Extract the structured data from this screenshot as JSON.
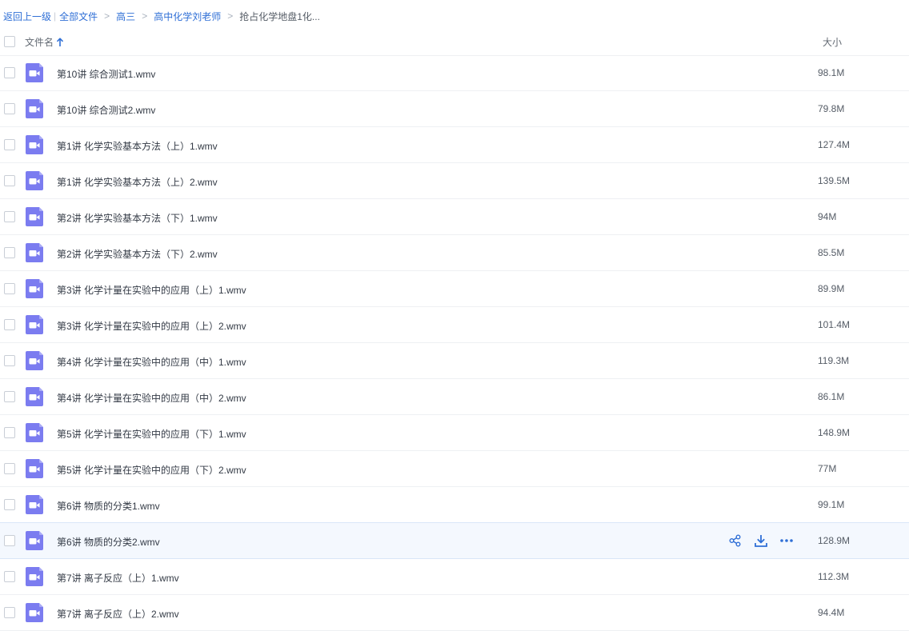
{
  "breadcrumb": {
    "back": "返回上一级",
    "pipe": "|",
    "items": [
      "全部文件",
      "高三",
      "高中化学刘老师"
    ],
    "sep": ">",
    "current": "抢占化学地盘1化..."
  },
  "header": {
    "name_label": "文件名",
    "size_label": "大小",
    "sort": "ascending"
  },
  "colors": {
    "accent": "#2f6fd6",
    "file_icon": "#7b7cf0",
    "hover_row": "#f4f8fe"
  },
  "files": [
    {
      "name": "第10讲 综合测试1.wmv",
      "size": "98.1M",
      "icon": "video-file-icon"
    },
    {
      "name": "第10讲 综合测试2.wmv",
      "size": "79.8M",
      "icon": "video-file-icon"
    },
    {
      "name": "第1讲 化学实验基本方法（上）1.wmv",
      "size": "127.4M",
      "icon": "video-file-icon"
    },
    {
      "name": "第1讲 化学实验基本方法（上）2.wmv",
      "size": "139.5M",
      "icon": "video-file-icon"
    },
    {
      "name": "第2讲 化学实验基本方法（下）1.wmv",
      "size": "94M",
      "icon": "video-file-icon"
    },
    {
      "name": "第2讲 化学实验基本方法（下）2.wmv",
      "size": "85.5M",
      "icon": "video-file-icon"
    },
    {
      "name": "第3讲 化学计量在实验中的应用（上）1.wmv",
      "size": "89.9M",
      "icon": "video-file-icon"
    },
    {
      "name": "第3讲 化学计量在实验中的应用（上）2.wmv",
      "size": "101.4M",
      "icon": "video-file-icon"
    },
    {
      "name": "第4讲 化学计量在实验中的应用（中）1.wmv",
      "size": "119.3M",
      "icon": "video-file-icon"
    },
    {
      "name": "第4讲 化学计量在实验中的应用（中）2.wmv",
      "size": "86.1M",
      "icon": "video-file-icon"
    },
    {
      "name": "第5讲 化学计量在实验中的应用（下）1.wmv",
      "size": "148.9M",
      "icon": "video-file-icon"
    },
    {
      "name": "第5讲 化学计量在实验中的应用（下）2.wmv",
      "size": "77M",
      "icon": "video-file-icon"
    },
    {
      "name": "第6讲 物质的分类1.wmv",
      "size": "99.1M",
      "icon": "video-file-icon"
    },
    {
      "name": "第6讲 物质的分类2.wmv",
      "size": "128.9M",
      "icon": "video-file-icon",
      "hovered": true
    },
    {
      "name": "第7讲 离子反应（上）1.wmv",
      "size": "112.3M",
      "icon": "video-file-icon"
    },
    {
      "name": "第7讲 离子反应（上）2.wmv",
      "size": "94.4M",
      "icon": "video-file-icon"
    }
  ]
}
